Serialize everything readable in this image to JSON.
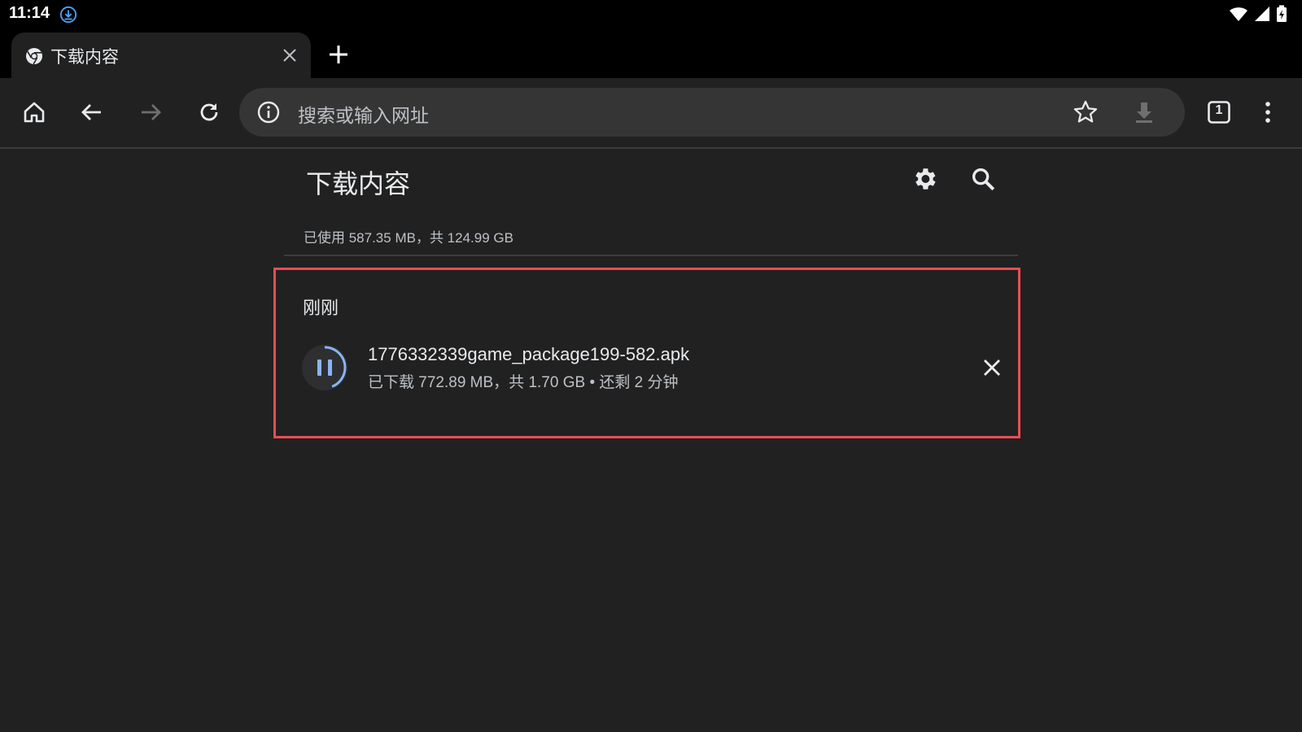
{
  "status_bar": {
    "time": "11:14"
  },
  "tab": {
    "title": "下载内容"
  },
  "omnibox": {
    "placeholder": "搜索或输入网址"
  },
  "toolbar": {
    "tab_count": "1"
  },
  "downloads": {
    "title": "下载内容",
    "storage": "已使用 587.35 MB，共 124.99 GB",
    "section_label": "刚刚",
    "item": {
      "file_name": "1776332339game_package199-582.apk",
      "status": "已下载 772.89 MB，共 1.70 GB • 还剩 2 分钟",
      "progress_fraction": 0.44
    }
  },
  "colors": {
    "background": "#212121",
    "highlight": "#ea4d53",
    "progress_accent": "#8ab4f8"
  }
}
